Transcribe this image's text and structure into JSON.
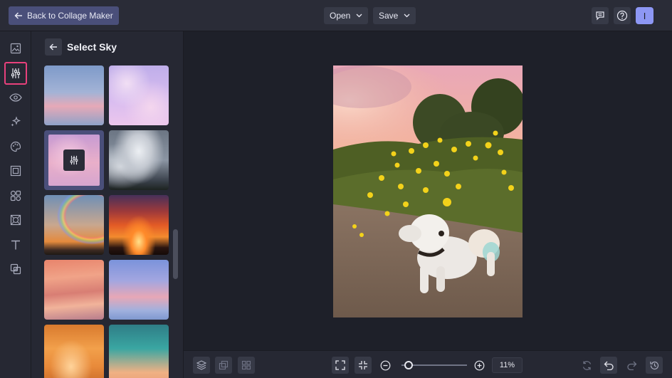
{
  "topbar": {
    "back_label": "Back to Collage Maker",
    "open_label": "Open",
    "save_label": "Save",
    "avatar_initial": "I"
  },
  "rail": {
    "items": [
      {
        "icon": "image-icon"
      },
      {
        "icon": "adjust-sliders-icon",
        "active": true
      },
      {
        "icon": "eye-icon"
      },
      {
        "icon": "sparkle-icon"
      },
      {
        "icon": "palette-icon"
      },
      {
        "icon": "frame-icon"
      },
      {
        "icon": "shapes-icon"
      },
      {
        "icon": "texture-icon"
      },
      {
        "icon": "text-icon"
      },
      {
        "icon": "overlay-icon"
      }
    ]
  },
  "panel": {
    "title": "Select Sky",
    "skies": [
      {
        "name": "sky-blue-pink-horizon"
      },
      {
        "name": "sky-lavender-clouds"
      },
      {
        "name": "sky-pink-soft",
        "selected": true
      },
      {
        "name": "sky-storm-cumulus"
      },
      {
        "name": "sky-rainbow-sunset"
      },
      {
        "name": "sky-fiery-sunset"
      },
      {
        "name": "sky-peach-streaks"
      },
      {
        "name": "sky-periwinkle-dusk"
      },
      {
        "name": "sky-golden-clouds"
      },
      {
        "name": "sky-teal-gradient"
      }
    ]
  },
  "bottombar": {
    "zoom_label": "11%",
    "zoom_value": 0.11
  },
  "colors": {
    "accent": "#4a4f7a",
    "active_outline": "#e8417c",
    "avatar": "#8d97f4",
    "background": "#1e2029"
  }
}
